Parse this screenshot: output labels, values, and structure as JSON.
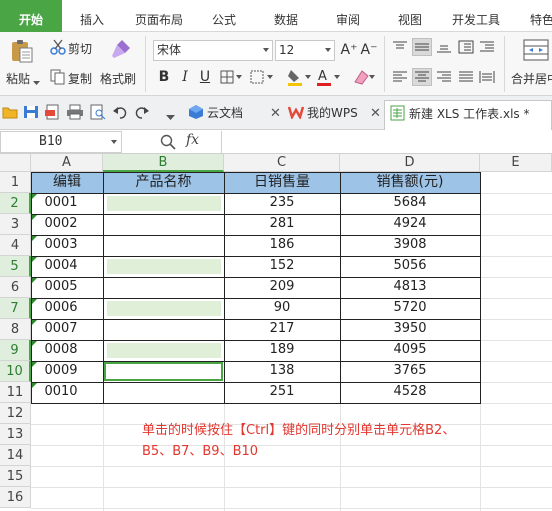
{
  "menu": {
    "tabs": [
      "开始",
      "插入",
      "页面布局",
      "公式",
      "数据",
      "审阅",
      "视图",
      "开发工具",
      "特色应"
    ]
  },
  "ribbon": {
    "paste_label": "粘贴",
    "cut_label": "剪切",
    "copy_label": "复制",
    "format_painter_label": "格式刷",
    "font_name": "宋体",
    "font_size": "12",
    "grow_font": "A⁺",
    "shrink_font": "A⁻",
    "bold": "B",
    "italic": "I",
    "underline": "U",
    "merge_label": "合并居中"
  },
  "doc_tabs": {
    "cloud_label": "云文档",
    "mywps_label": "我的WPS",
    "file_label": "新建 XLS 工作表.xls *"
  },
  "formula_bar": {
    "name_box": "B10",
    "fx_label": "fx",
    "formula": ""
  },
  "sheet": {
    "columns": [
      "A",
      "B",
      "C",
      "D",
      "E"
    ],
    "rows": [
      "1",
      "2",
      "3",
      "4",
      "5",
      "6",
      "7",
      "8",
      "9",
      "10",
      "11",
      "12",
      "13",
      "14",
      "15",
      "16"
    ],
    "header_row": [
      "编辑",
      "产品名称",
      "日销售量",
      "销售额(元)"
    ],
    "data": [
      {
        "a": "0001",
        "b": "",
        "c": "235",
        "d": "5684"
      },
      {
        "a": "0002",
        "b": "",
        "c": "281",
        "d": "4924"
      },
      {
        "a": "0003",
        "b": "",
        "c": "186",
        "d": "3908"
      },
      {
        "a": "0004",
        "b": "",
        "c": "152",
        "d": "5056"
      },
      {
        "a": "0005",
        "b": "",
        "c": "209",
        "d": "4813"
      },
      {
        "a": "0006",
        "b": "",
        "c": "90",
        "d": "5720"
      },
      {
        "a": "0007",
        "b": "",
        "c": "217",
        "d": "3950"
      },
      {
        "a": "0008",
        "b": "",
        "c": "189",
        "d": "4095"
      },
      {
        "a": "0009",
        "b": "",
        "c": "138",
        "d": "3765"
      },
      {
        "a": "0010",
        "b": "",
        "c": "251",
        "d": "4528"
      }
    ],
    "selected_cells": [
      "B2",
      "B5",
      "B7",
      "B9",
      "B10"
    ],
    "active_cell": "B10",
    "note_line1": "单击的时候按住【Ctrl】键的同时分别单击单元格B2、",
    "note_line2": "B5、B7、B9、B10"
  },
  "colors": {
    "accent": "#4aa545",
    "header_fill": "#9dc3e6",
    "selection_fill": "#e0f0d8",
    "note_text": "#e2362e"
  }
}
